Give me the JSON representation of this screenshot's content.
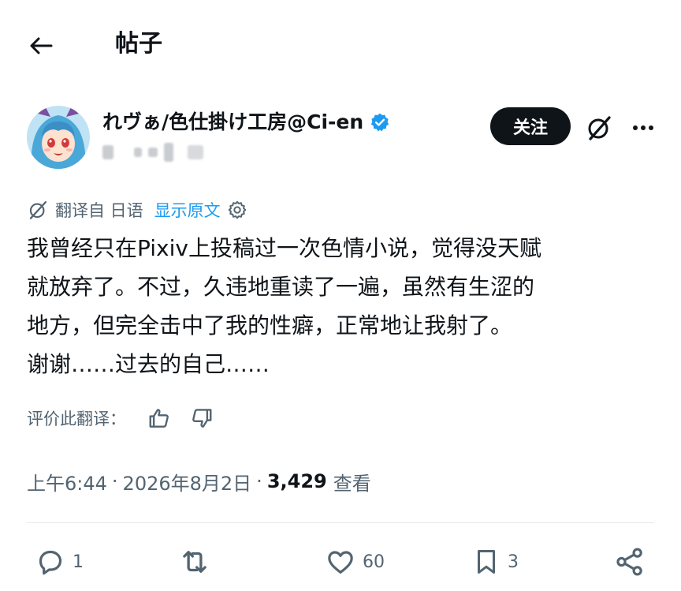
{
  "header": {
    "title": "帖子"
  },
  "author": {
    "name": "れヴぁ/色仕掛け工房@Ci-en",
    "verified": true,
    "follow_label": "关注"
  },
  "translation": {
    "label": "翻译自 日语",
    "show_original": "显示原文"
  },
  "post": {
    "lines": [
      "我曾经只在Pixiv上投稿过一次色情小说，觉得没天赋",
      "就放弃了。不过，久违地重读了一遍，虽然有生涩的",
      "地方，但完全击中了我的性癖，正常地让我射了。",
      "谢谢……过去的自己……"
    ]
  },
  "rate": {
    "label": "评价此翻译："
  },
  "meta": {
    "time": "上午6:44",
    "date": "2026年8月2日",
    "views_count": "3,429",
    "views_label": "查看",
    "separator": "·"
  },
  "actions": {
    "replies": "1",
    "reposts": "",
    "likes": "60",
    "bookmarks": "3"
  },
  "colors": {
    "text": "#0f1419",
    "secondary": "#536471",
    "accent": "#1d9bf0",
    "verified": "#1d9bf0",
    "follow_bg": "#0f1419"
  },
  "icons": {
    "back": "arrow-left-icon",
    "verified": "verified-badge-icon",
    "grok": "grok-icon",
    "more": "more-horizontal-icon",
    "translate": "grok-translate-icon",
    "settings": "gear-icon",
    "thumbs_up": "thumbs-up-icon",
    "thumbs_down": "thumbs-down-icon",
    "reply": "reply-icon",
    "repost": "repost-icon",
    "like": "heart-icon",
    "bookmark": "bookmark-icon",
    "share": "share-icon"
  }
}
